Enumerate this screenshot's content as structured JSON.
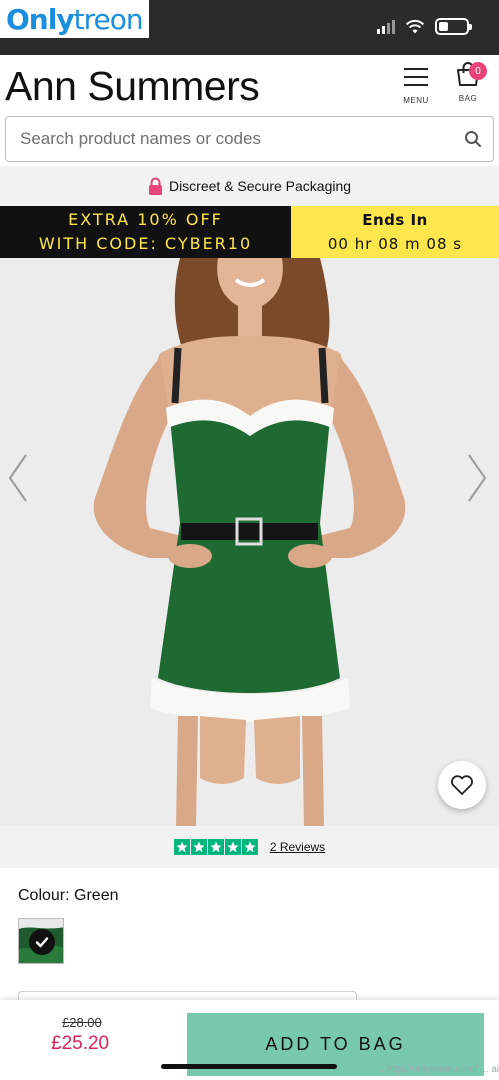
{
  "watermark": {
    "part1": "Only",
    "part2": "treon",
    "footer_text": "...http://onlytreon.com/ ... ai"
  },
  "header": {
    "brand": "Ann Summers",
    "menu_label": "MENU",
    "bag_label": "BAG",
    "bag_count": "0"
  },
  "search": {
    "placeholder": "Search product names or codes"
  },
  "discreet": {
    "text": "Discreet & Secure Packaging"
  },
  "promo": {
    "line1": "EXTRA 10% OFF",
    "line2": "WITH CODE: CYBER10",
    "ends_label": "Ends In",
    "countdown": "00 hr 08 m 08 s"
  },
  "product": {
    "image_alt": "Green velvet dress with white faux-fur trim and black belt",
    "reviews_link": "2 Reviews",
    "rating_stars": 5,
    "colour_label": "Colour: Green",
    "swatch_color": "#1f5b2d"
  },
  "purchase": {
    "old_price": "£28.00",
    "new_price": "£25.20",
    "add_to_bag": "ADD TO BAG"
  },
  "colors": {
    "accent_pink": "#e8447a",
    "price_pink": "#d4245c",
    "promo_yellow": "#fde74c",
    "add_button": "#78c8ae",
    "trustpilot_green": "#00b67a"
  }
}
